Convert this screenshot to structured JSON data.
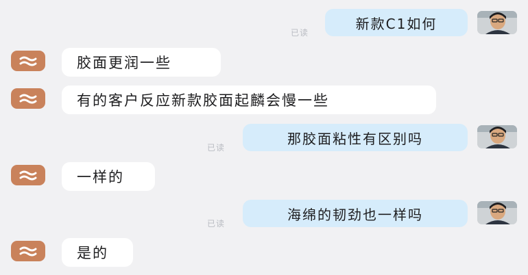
{
  "messages": [
    {
      "side": "right",
      "text": "新款C1如何",
      "status": "已读"
    },
    {
      "side": "left",
      "text": "胶面更润一些"
    },
    {
      "side": "left",
      "text": "有的客户反应新款胶面起麟会慢一些"
    },
    {
      "side": "right",
      "text": "那胶面粘性有区别吗",
      "status": "已读"
    },
    {
      "side": "left",
      "text": "一样的"
    },
    {
      "side": "right",
      "text": "海绵的韧劲也一样吗",
      "status": "已读"
    },
    {
      "side": "left",
      "text": "是的"
    }
  ],
  "colors": {
    "background": "#f1f1f3",
    "incoming_bubble": "#ffffff",
    "outgoing_bubble": "#d6ecfb",
    "incoming_avatar": "#c9825b",
    "read_status": "#b9bcc2"
  },
  "icons": {
    "incoming_avatar": "wave-logo-icon",
    "outgoing_avatar": "user-photo-avatar"
  }
}
